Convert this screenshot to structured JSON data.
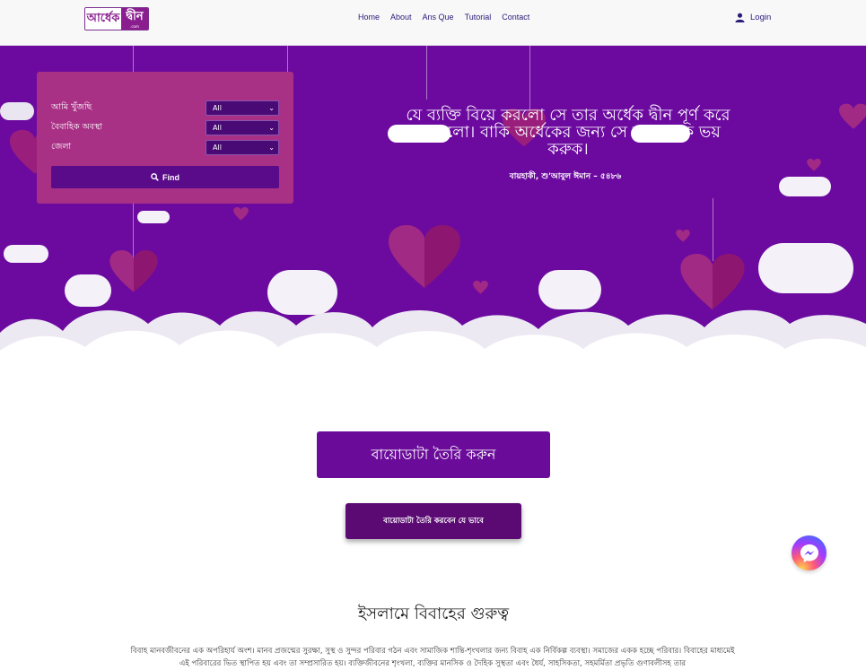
{
  "brand": {
    "logo_text_left": "আর্ধেক",
    "logo_text_right": "দ্বীন",
    "logo_sub": ".com"
  },
  "nav": {
    "items": [
      "Home",
      "About",
      "Ans Que",
      "Tutorial",
      "Contact"
    ],
    "login_label": "Login"
  },
  "search": {
    "rows": [
      {
        "label": "আমি খুঁজছি",
        "value": "All"
      },
      {
        "label": "বৈবাহিক অবস্থা",
        "value": "All"
      },
      {
        "label": "জেলা",
        "value": "All"
      }
    ],
    "find_label": "Find"
  },
  "hero": {
    "quote": "যে ব্যক্তি বিয়ে করলো সে তার অর্ধেক দ্বীন পূর্ণ করে ফেললো। বাকি অর্ধেকের জন্য সে আল্লাহকে ভয় করুক।",
    "source": "বায়হাকী, শু'আবুল ঈমান – ৫৪৮৬"
  },
  "cta": {
    "create_biodata": "বায়োডাটা তৈরি করুন",
    "how_to": "বায়োডাটা তৈরি করবেন যে ভাবে"
  },
  "section": {
    "title": "ইসলামে বিবাহের গুরুত্ব",
    "paragraph": "বিবাহ মানবজীবনের এক অপরিহার্য অংশ। মানব প্রজন্মের সুরক্ষা, সুস্থ ও সুন্দর পরিবার গঠন এবং সামাজিক শান্তি-শৃংখলার জন্য বিবাহ এক নির্বিকল্প ব্যবস্থা। সমাজের একক হচ্ছে পরিবার। বিবাহের মাধ্যমেই এই পরিবারের ভিত স্থাপিত হয় এবং তা সম্প্রসারিত হয়। ব্যক্তিজীবনের শৃংখলা, ব্যক্তির মানসিক ও দৈহিক সুস্থতা এবং ধৈর্য, সাহসিকতা, সহমর্মিতা প্রভৃতি গুণাবলীসহ তার"
  },
  "colors": {
    "hero_bg": "#6c0aa0",
    "search_bg": "#a83186",
    "button_primary": "#6a0b9a",
    "button_secondary": "#5b0a73"
  },
  "icons": {
    "login": "user-icon",
    "find": "search-icon",
    "messenger": "messenger-icon"
  }
}
